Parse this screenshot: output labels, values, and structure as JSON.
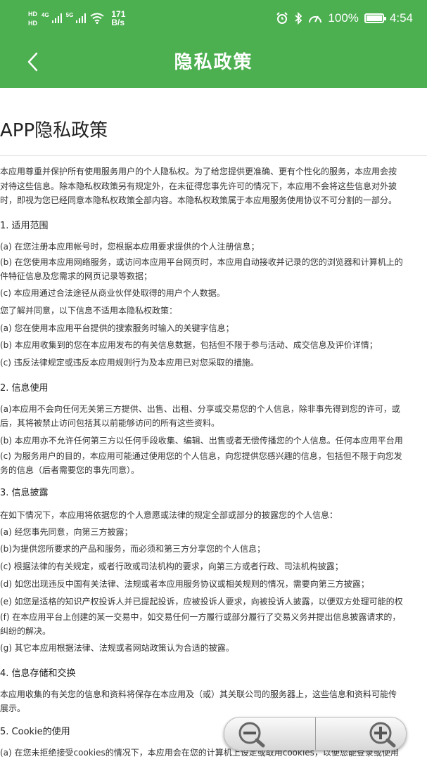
{
  "status_bar": {
    "hd1": "HD",
    "hd2": "HD",
    "net1": "4G",
    "net2": "5G",
    "speed_value": "171",
    "speed_unit": "B/s",
    "battery": "100%",
    "battery_level": 1.0,
    "time": "4:54"
  },
  "header": {
    "title": "隐私政策",
    "color": "#4caf50"
  },
  "doc": {
    "title": "APP隐私政策",
    "lines": [
      {
        "t": "本应用尊重并保护所有使用服务用户的个人隐私权。为了给您提供更准确、更有个性化的服务，本应用会按"
      },
      {
        "t": "对待这些信息。除本隐私权政策另有规定外，在未征得您事先许可的情况下，本应用不会将这些信息对外披"
      },
      {
        "t": "时，即视为您已经同意本隐私权政策全部内容。本隐私权政策属于本应用服务使用协议不可分割的一部分。"
      },
      {
        "t": "1. 适用范围",
        "h": true
      },
      {
        "t": "(a) 在您注册本应用帐号时，您根据本应用要求提供的个人注册信息；"
      },
      {
        "t": "(b) 在您使用本应用网络服务，或访问本应用平台网页时，本应用自动接收并记录的您的浏览器和计算机上的"
      },
      {
        "t": "件特征信息及您需求的网页记录等数据；"
      },
      {
        "t": "(c) 本应用通过合法途径从商业伙伴处取得的用户个人数据。"
      },
      {
        "t": "您了解并同意，以下信息不适用本隐私权政策："
      },
      {
        "t": "(a) 您在使用本应用平台提供的搜索服务时输入的关键字信息；"
      },
      {
        "t": "(b) 本应用收集到的您在本应用发布的有关信息数据，包括但不限于参与活动、成交信息及评价详情；"
      },
      {
        "t": "(c) 违反法律规定或违反本应用规则行为及本应用已对您采取的措施。"
      },
      {
        "t": "2. 信息使用",
        "h": true
      },
      {
        "t": "(a)本应用不会向任何无关第三方提供、出售、出租、分享或交易您的个人信息，除非事先得到您的许可，或"
      },
      {
        "t": "后，其将被禁止访问包括其以前能够访问的所有这些资料。"
      },
      {
        "t": "(b) 本应用亦不允许任何第三方以任何手段收集、编辑、出售或者无偿传播您的个人信息。任何本应用平台用"
      },
      {
        "t": "(c) 为服务用户的目的，本应用可能通过使用您的个人信息，向您提供您感兴趣的信息，包括但不限于向您发"
      },
      {
        "t": "务的信息（后者需要您的事先同意）。"
      },
      {
        "t": "3. 信息披露",
        "h": true
      },
      {
        "t": "在如下情况下，本应用将依据您的个人意愿或法律的规定全部或部分的披露您的个人信息："
      },
      {
        "t": "(a) 经您事先同意，向第三方披露；"
      },
      {
        "t": "(b)为提供您所要求的产品和服务，而必须和第三方分享您的个人信息；"
      },
      {
        "t": "(c) 根据法律的有关规定，或者行政或司法机构的要求，向第三方或者行政、司法机构披露；"
      },
      {
        "t": "(d) 如您出现违反中国有关法律、法规或者本应用服务协议或相关规则的情况，需要向第三方披露；"
      },
      {
        "t": "(e) 如您是适格的知识产权投诉人并已提起投诉，应被投诉人要求，向被投诉人披露，以便双方处理可能的权"
      },
      {
        "t": "(f) 在本应用平台上创建的某一交易中，如交易任何一方履行或部分履行了交易义务并提出信息披露请求的，"
      },
      {
        "t": "纠纷的解决。"
      },
      {
        "t": "(g) 其它本应用根据法律、法规或者网站政策认为合适的披露。"
      },
      {
        "t": "4. 信息存储和交换",
        "h": true
      },
      {
        "t": "本应用收集的有关您的信息和资料将保存在本应用及（或）其关联公司的服务器上，这些信息和资料可能传"
      },
      {
        "t": "展示。"
      },
      {
        "t": "5. Cookie的使用",
        "h": true
      },
      {
        "t": "(a) 在您未拒绝接受cookies的情况下，本应用会在您的计算机上设定或取用cookies，以便您能登录或使用"
      }
    ]
  }
}
